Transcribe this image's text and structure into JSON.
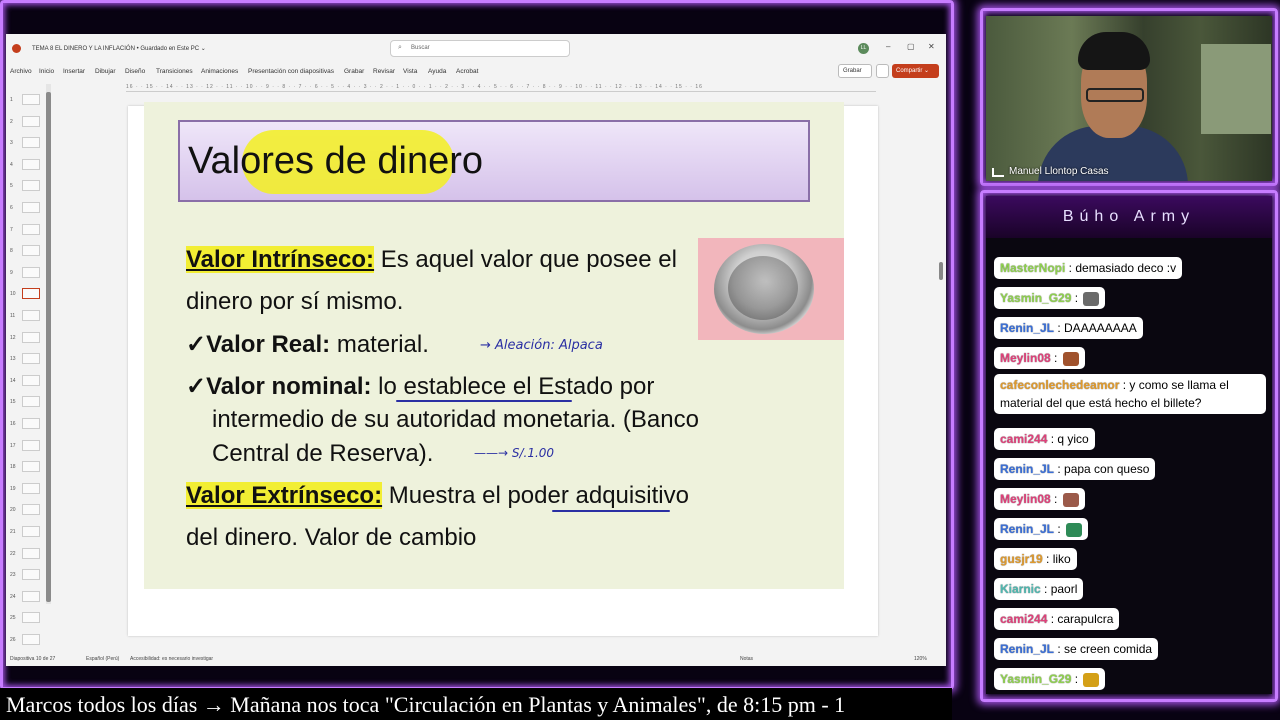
{
  "window": {
    "title": "TEMA 8 EL DINERO Y LA INFLACIÓN • Guardado en Este PC ⌄",
    "search_placeholder": "Buscar",
    "user_initials": "LL",
    "minimize": "–",
    "maximize": "▢",
    "close": "✕"
  },
  "menu": [
    "Archivo",
    "Inicio",
    "Insertar",
    "Dibujar",
    "Diseño",
    "Transiciones",
    "Animaciones",
    "Presentación con diapositivas",
    "Grabar",
    "Revisar",
    "Vista",
    "Ayuda",
    "Acrobat"
  ],
  "toolbar": {
    "record_label": "Grabar",
    "share_label": "Compartir ⌄"
  },
  "ruler": "16 · · 15 · · 14 · · 13 · · 12 · · 11 · · 10 · · 9 · · 8 · · 7 · · 6 · · 5 · · 4 · · 3 · · 2 · · 1 · · 0 · · 1 · · 2 · · 3 · · 4 · · 5 · · 6 · · 7 · · 8 · · 9 · · 10 · · 11 · · 12 · · 13 · · 14 · · 15 · · 16",
  "thumbnails": [
    "1",
    "2",
    "3",
    "4",
    "5",
    "6",
    "7",
    "8",
    "9",
    "10",
    "11",
    "12",
    "13",
    "14",
    "15",
    "16",
    "17",
    "18",
    "19",
    "20",
    "21",
    "22",
    "23",
    "24",
    "25",
    "26"
  ],
  "slide": {
    "title": "Valores de dinero",
    "intrinsic_label": "Valor Intrínseco:",
    "intrinsic_text": " Es aquel valor que posee el",
    "intrinsic_text2": "dinero por sí mismo.",
    "real_label": "✓Valor Real:",
    "real_text": " material.",
    "nominal_label": "✓Valor nominal:",
    "nominal_text": " lo establece el Estado por",
    "nominal_text2": "intermedio de  su autoridad monetaria. (Banco",
    "nominal_text3": "Central de Reserva).",
    "extrinsic_label": "Valor Extrínseco:",
    "extrinsic_text": " Muestra el poder adquisitivo",
    "extrinsic_text2": "del dinero. Valor de cambio",
    "annot_alloy": "→ Aleación: Alpaca",
    "annot_price": "——→   S/.1.00"
  },
  "status": {
    "slide_count": "Diapositiva 10 de 27",
    "language": "Español (Perú)",
    "accessibility": "Accesibilidad: es necesario investigar",
    "notes": "Notas",
    "zoom": "120%"
  },
  "webcam": {
    "name": "Manuel Llontop Casas"
  },
  "chat": {
    "title": "Búho Army",
    "messages": [
      {
        "user": "MasterNopi",
        "color": "#8fd14f",
        "text": " : demasiado deco :v"
      },
      {
        "user": "Yasmin_G29",
        "color": "#8fd14f",
        "text": " : ",
        "emoji": "#6a6a6a"
      },
      {
        "user": "Renin_JL",
        "color": "#3a6fd8",
        "text": " : DAAAAAAAA"
      },
      {
        "user": "Meylin08",
        "color": "#e0407a",
        "text": " : ",
        "emoji": "#a0522d"
      },
      {
        "user": "cafeconlechedeamor",
        "color": "#e09a2c",
        "text": " : y como se llama el material del que está hecho el billete?"
      },
      {
        "user": "cami244",
        "color": "#e0407a",
        "text": " : q yico"
      },
      {
        "user": "Renin_JL",
        "color": "#3a6fd8",
        "text": " : papa con queso"
      },
      {
        "user": "Meylin08",
        "color": "#e0407a",
        "text": " : ",
        "emoji": "#9b5a4a"
      },
      {
        "user": "Renin_JL",
        "color": "#3a6fd8",
        "text": " : ",
        "emoji": "#2e8b57"
      },
      {
        "user": "gusjr19",
        "color": "#e09a2c",
        "text": " : liko"
      },
      {
        "user": "Kiarnic",
        "color": "#4fb8b0",
        "text": " : paorl"
      },
      {
        "user": "cami244",
        "color": "#e0407a",
        "text": " : carapulcra"
      },
      {
        "user": "Renin_JL",
        "color": "#3a6fd8",
        "text": " : se creen comida"
      },
      {
        "user": "Yasmin_G29",
        "color": "#8fd14f",
        "text": " : ",
        "emoji": "#d4a017"
      }
    ]
  },
  "ticker": "Marcos todos los días  →  Mañana nos toca \"Circulación en Plantas y Animales\", de 8:15 pm - 1",
  "colors": {
    "neon": "#c77dff",
    "highlight": "#f2ee33",
    "share": "#c43e1c"
  }
}
